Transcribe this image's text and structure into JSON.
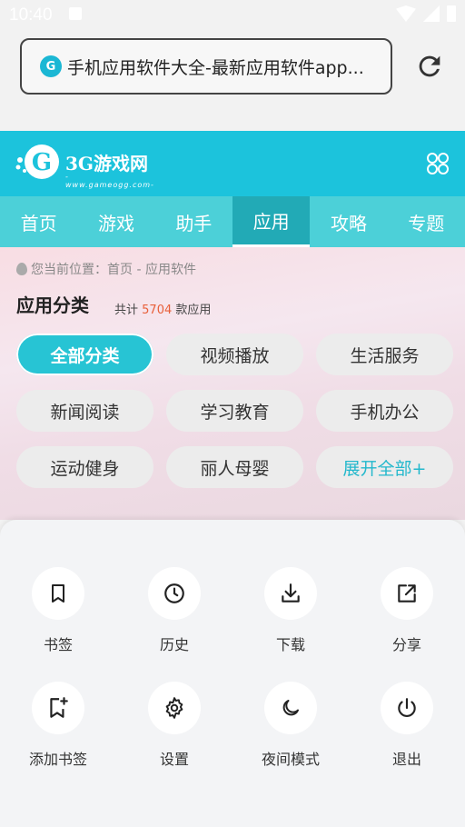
{
  "status": {
    "time": "10:40"
  },
  "browser": {
    "url_text": "手机应用软件大全-最新应用软件app..."
  },
  "site": {
    "brand": "3G游戏网",
    "sub": "-www.gameogg.com-",
    "nav": [
      "首页",
      "游戏",
      "助手",
      "应用",
      "攻略",
      "专题"
    ],
    "nav_active_index": 3,
    "breadcrumb": "您当前位置：首页 - 应用软件",
    "category_title": "应用分类",
    "count_prefix": "共计",
    "count_value": "5704",
    "count_suffix": "款应用",
    "chips": [
      "全部分类",
      "视频播放",
      "生活服务",
      "新闻阅读",
      "学习教育",
      "手机办公",
      "运动健身",
      "丽人母婴",
      "展开全部+"
    ],
    "colors": {
      "brand": "#1cc3dc",
      "accent_orange": "#e8603a"
    }
  },
  "menu": {
    "items": [
      {
        "label": "书签",
        "icon": "bookmark-icon"
      },
      {
        "label": "历史",
        "icon": "history-clock-icon"
      },
      {
        "label": "下载",
        "icon": "download-icon"
      },
      {
        "label": "分享",
        "icon": "share-icon"
      },
      {
        "label": "添加书签",
        "icon": "add-bookmark-icon"
      },
      {
        "label": "设置",
        "icon": "gear-icon"
      },
      {
        "label": "夜间模式",
        "icon": "moon-icon"
      },
      {
        "label": "退出",
        "icon": "power-icon"
      }
    ]
  }
}
